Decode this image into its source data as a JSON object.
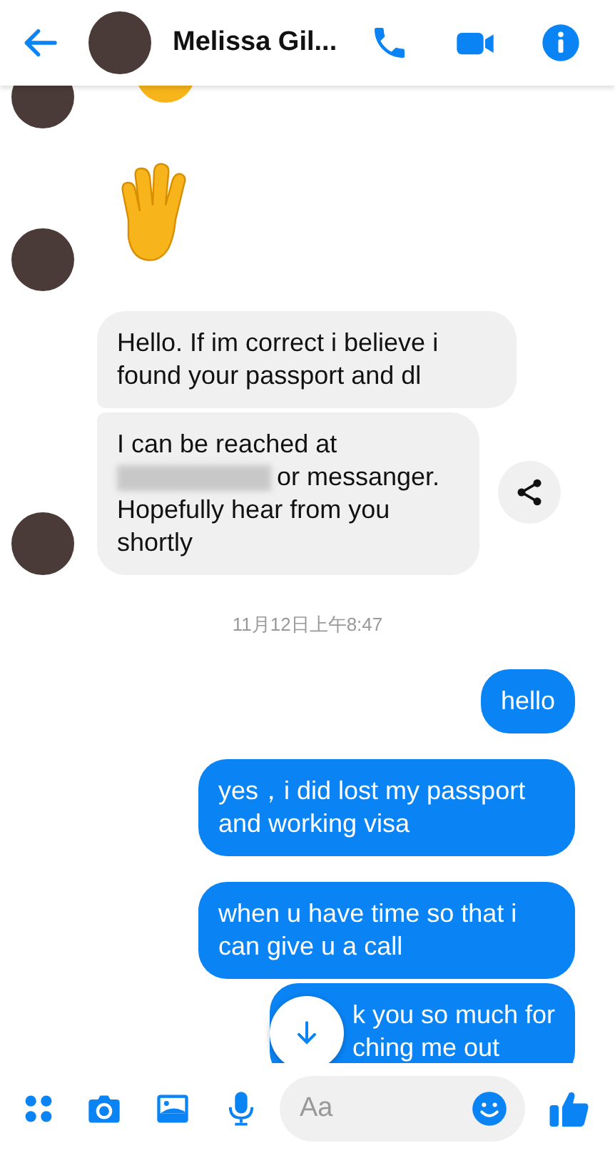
{
  "header": {
    "contact_name": "Melissa Gil..."
  },
  "messages": [
    {
      "kind": "emoji",
      "outgoing": false
    },
    {
      "kind": "text",
      "outgoing": false,
      "text": "Hello. If im correct i believe i found your passport and dl"
    },
    {
      "kind": "redacted",
      "outgoing": false,
      "parts": [
        "I can be reached at",
        "or messanger. Hopefully hear from you shortly"
      ]
    },
    {
      "kind": "timestamp",
      "text": "11月12日上午8:47"
    },
    {
      "kind": "text",
      "outgoing": true,
      "text": "hello"
    },
    {
      "kind": "text",
      "outgoing": true,
      "text": "yes，i did lost my passport and working visa"
    },
    {
      "kind": "text",
      "outgoing": true,
      "text": "when u have time so that i can give u a call"
    },
    {
      "kind": "covered",
      "outgoing": true,
      "lines": [
        "k you so much for",
        "ching me out"
      ]
    }
  ],
  "composer": {
    "placeholder": "Aa"
  }
}
